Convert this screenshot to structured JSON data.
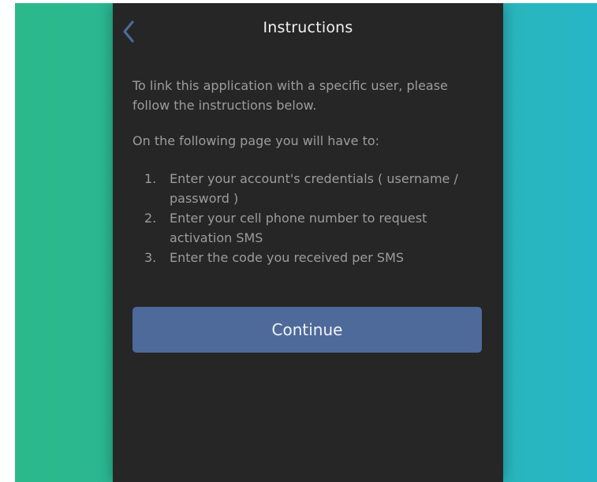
{
  "header": {
    "back_icon": "chevron-left-icon",
    "title": "Instructions"
  },
  "body": {
    "intro": "To link this application with a specific user, please follow the instructions below.",
    "lead": "On the following page you will have to:",
    "steps": [
      {
        "num": "1.",
        "text": "Enter your account's credentials ( username / password )"
      },
      {
        "num": "2.",
        "text": "Enter your cell phone number to request activation SMS"
      },
      {
        "num": "3.",
        "text": "Enter the code you received per SMS"
      }
    ]
  },
  "actions": {
    "continue_label": "Continue"
  },
  "colors": {
    "background_gradient_start": "#2bb88a",
    "background_gradient_end": "#27b6c8",
    "panel": "#262626",
    "button": "#4e6a9b",
    "accent_back": "#4e6a9b"
  }
}
